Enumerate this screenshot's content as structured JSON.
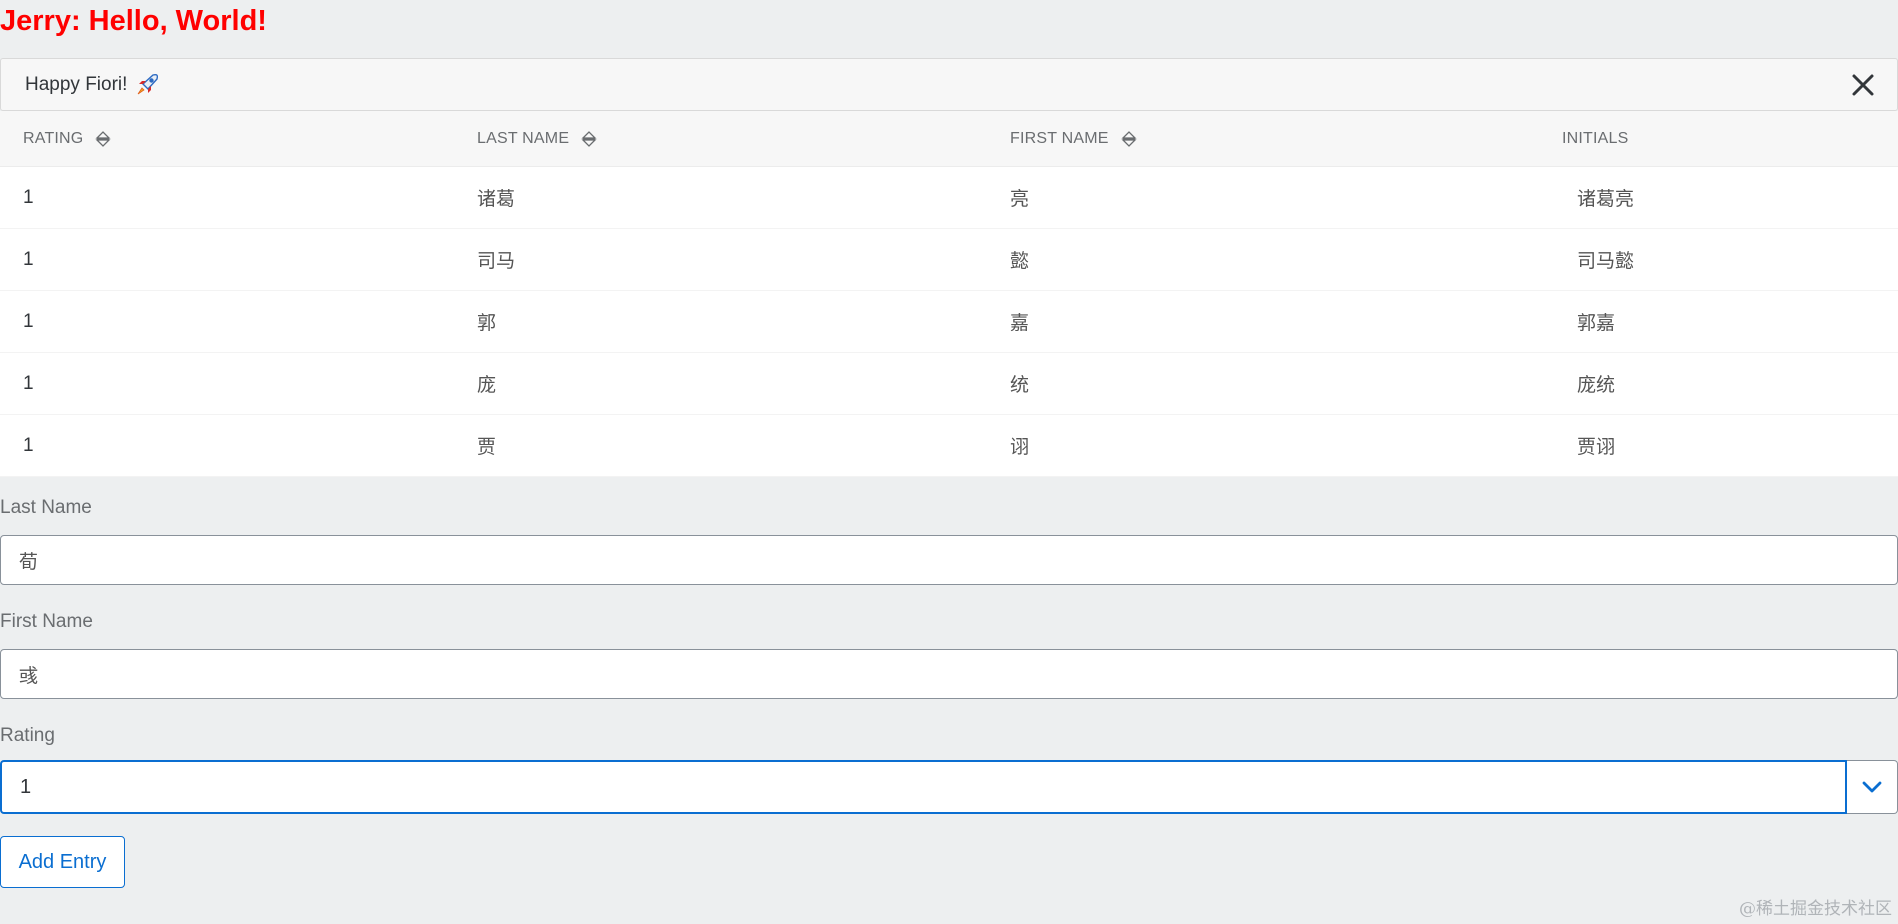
{
  "title": "Jerry: Hello, World!",
  "toast": {
    "text": "Happy Fiori!",
    "icon": "rocket-icon",
    "close_icon": "close-icon"
  },
  "table": {
    "headers": [
      "RATING",
      "LAST NAME",
      "FIRST NAME",
      "INITIALS"
    ],
    "rows": [
      {
        "rating": "1",
        "last": "诸葛",
        "first": "亮",
        "initials": "诸葛亮"
      },
      {
        "rating": "1",
        "last": "司马",
        "first": "懿",
        "initials": "司马懿"
      },
      {
        "rating": "1",
        "last": "郭",
        "first": "嘉",
        "initials": "郭嘉"
      },
      {
        "rating": "1",
        "last": "庞",
        "first": "统",
        "initials": "庞统"
      },
      {
        "rating": "1",
        "last": "贾",
        "first": "诩",
        "initials": "贾诩"
      }
    ]
  },
  "form": {
    "last_name_label": "Last Name",
    "last_name_value": "荀",
    "first_name_label": "First Name",
    "first_name_value": "彧",
    "rating_label": "Rating",
    "rating_value": "1",
    "add_button": "Add Entry"
  },
  "watermark": "@稀土掘金技术社区",
  "colors": {
    "title": "#ff0000",
    "accent": "#0a6ed1",
    "background": "#edeff0"
  }
}
